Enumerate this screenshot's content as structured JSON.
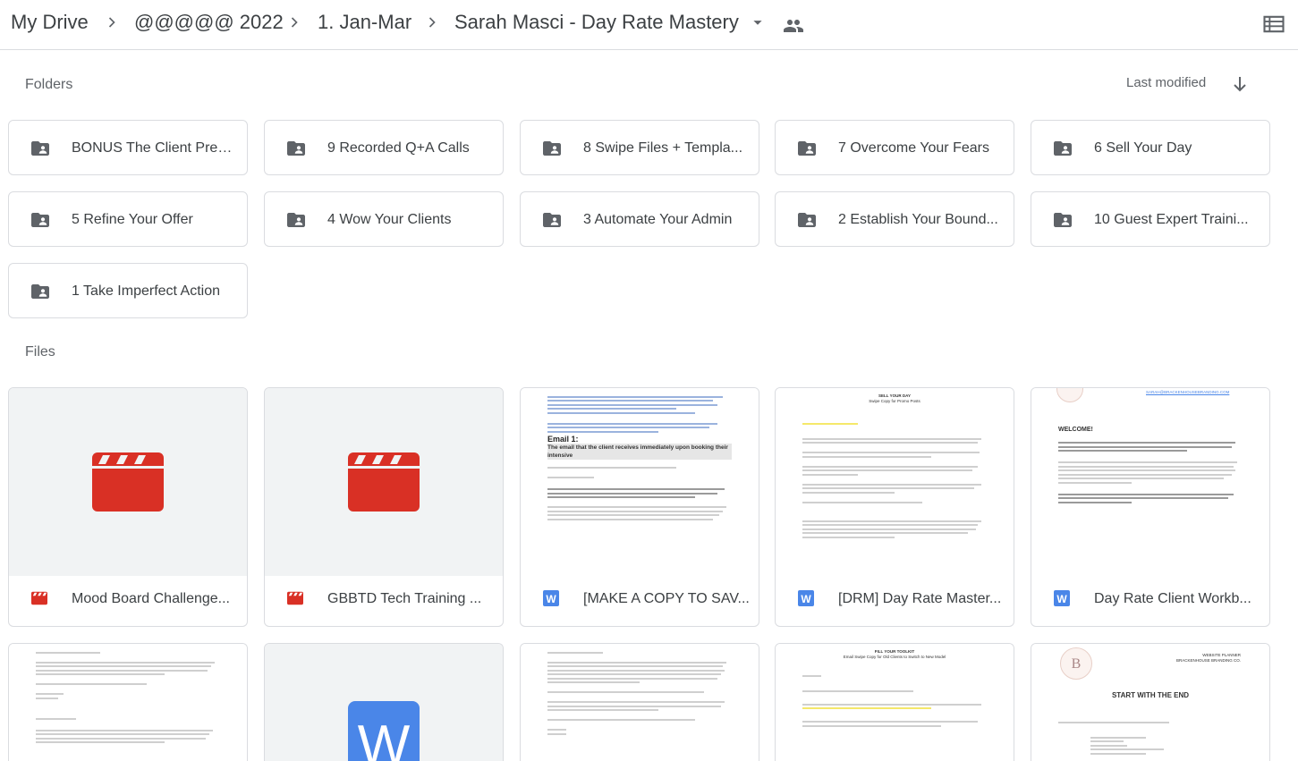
{
  "breadcrumb": {
    "items": [
      "My Drive",
      "@@@@@ 2022",
      "1. Jan-Mar",
      "Sarah Masci - Day Rate Mastery"
    ]
  },
  "icons": {
    "separator": "chevron-right-icon",
    "dropdown": "arrow-drop-down-icon",
    "shared": "people-icon",
    "view": "list-view-icon",
    "folder": "shared-folder-icon",
    "video": "video-clapper-icon",
    "doc": "word-doc-icon"
  },
  "folders_section": {
    "label": "Folders",
    "sort_label": "Last modified",
    "items": [
      "BONUS The Client Prep...",
      "9 Recorded Q+A Calls",
      "8 Swipe Files + Templa...",
      "7 Overcome Your Fears",
      "6 Sell Your Day",
      "5 Refine Your Offer",
      "4 Wow Your Clients",
      "3 Automate Your Admin",
      "2 Establish Your Bound...",
      "10 Guest Expert Traini...",
      "1 Take Imperfect Action"
    ]
  },
  "files_section": {
    "label": "Files",
    "items": [
      {
        "name": "Mood Board Challenge...",
        "type": "video"
      },
      {
        "name": "GBBTD Tech Training ...",
        "type": "video"
      },
      {
        "name": "[MAKE A COPY TO SAV...",
        "type": "doc"
      },
      {
        "name": "[DRM] Day Rate Master...",
        "type": "doc"
      },
      {
        "name": "Day Rate Client Workb...",
        "type": "doc"
      }
    ]
  },
  "thumbnails": {
    "copy_doc_heading": "Email 1:",
    "copy_doc_sub": "The email that the client receives immediately upon booking their intensive",
    "promo_title": "SELL YOUR DAY",
    "promo_sub": "Swipe Copy for Promo Posts",
    "workbook_heading": "WELCOME!",
    "workbook_brand": "SARAH@BRACKENHOUSEBRANDING.COM",
    "toolkit_title": "FILL YOUR TOOLKIT",
    "toolkit_sub": "Email Swipe Copy for Old Clients to Switch to New Model",
    "planner_heading": "START WITH THE END",
    "planner_title": "WEBSITE PLANNER",
    "planner_brand": "BRACKENHOUSE BRANDING CO.",
    "logo_letter": "B",
    "word_letter": "W"
  },
  "colors": {
    "folder_icon": "#5f6368",
    "video_red": "#d93025",
    "word_blue": "#4a86e8",
    "text": "#3c4043",
    "border": "#dadce0"
  }
}
